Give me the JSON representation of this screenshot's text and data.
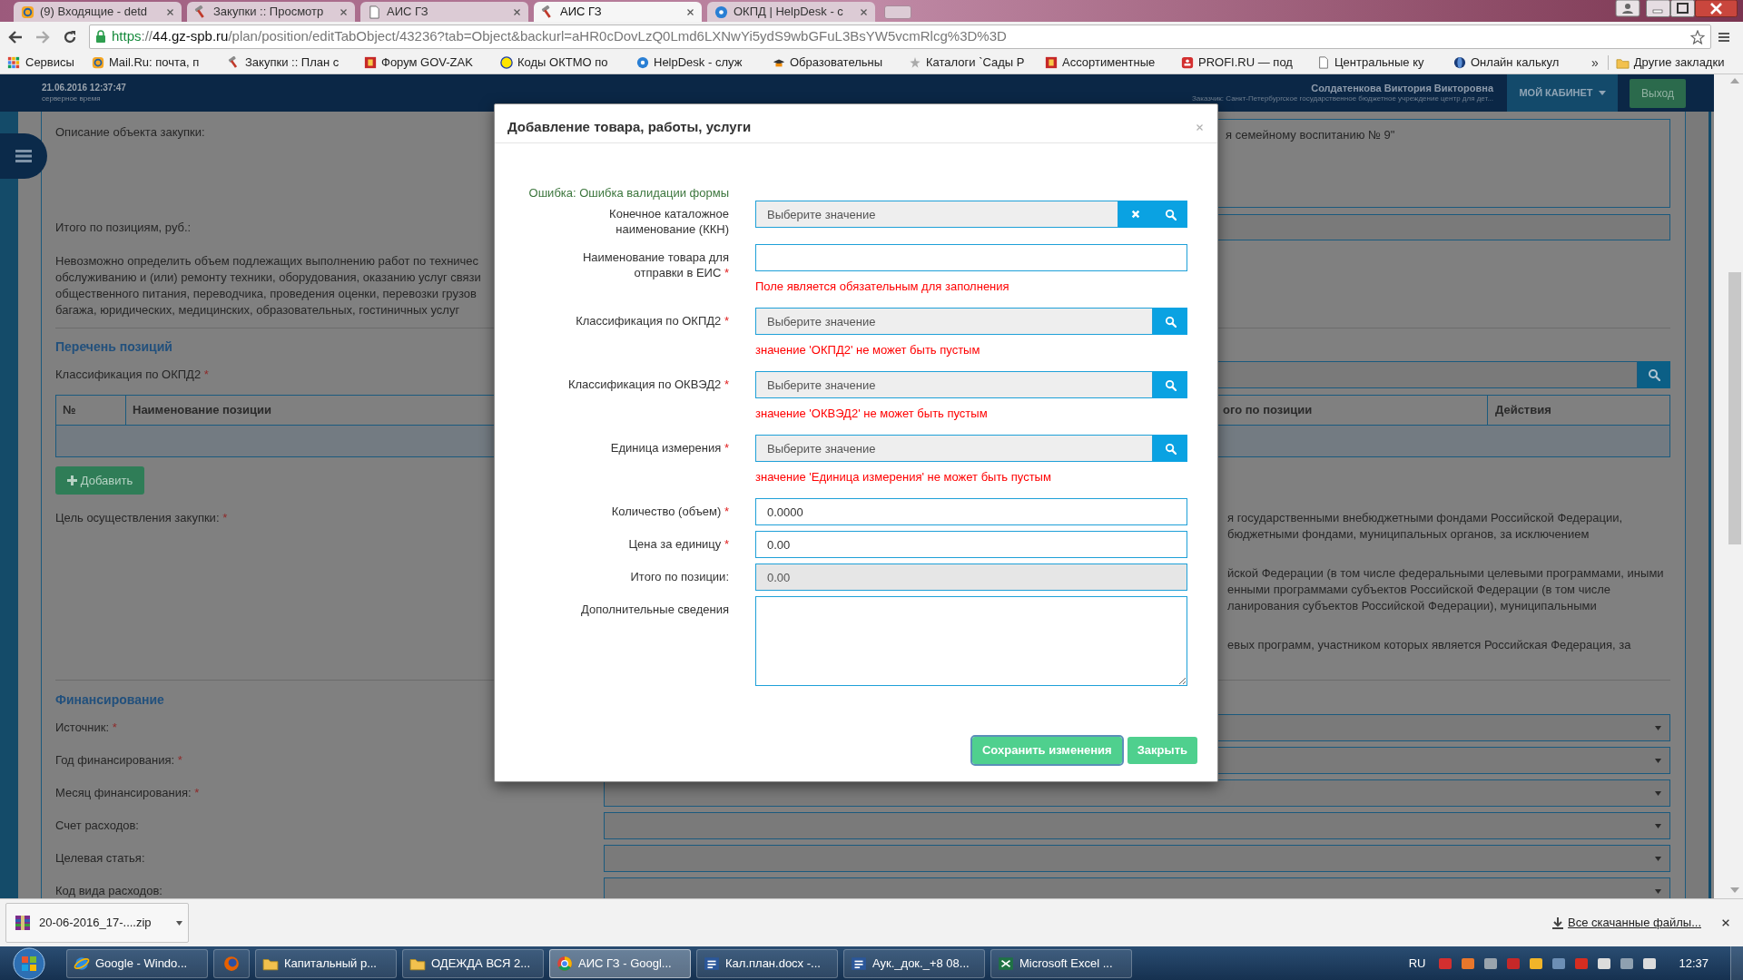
{
  "browser": {
    "tabs": [
      {
        "kind": "mail",
        "label": "(9) Входящие - detd",
        "selected": false
      },
      {
        "kind": "hammer",
        "label": "Закупки :: Просмотр",
        "selected": false
      },
      {
        "kind": "page",
        "label": "АИС ГЗ",
        "selected": false
      },
      {
        "kind": "hammer",
        "label": "АИС ГЗ",
        "selected": true
      },
      {
        "kind": "help",
        "label": "ОКПД | HelpDesk - с",
        "selected": false
      }
    ],
    "url": {
      "scheme": "https",
      "separator": "://",
      "host": "44.gz-spb.ru",
      "path": "/plan/position/editTabObject/43236?tab=Object&backurl=aHR0cDovLzQ0Lmd6LXNwYi5ydS9wbGFuL3BsYW5vcmRlcg%3D%3D"
    },
    "bookmarks": [
      {
        "kind": "apps",
        "label": "Сервисы"
      },
      {
        "kind": "mail",
        "label": "Mail.Ru: почта, п"
      },
      {
        "kind": "hammer",
        "label": "Закупки :: План с"
      },
      {
        "kind": "crest",
        "label": "Форум GOV-ZAK"
      },
      {
        "kind": "dot",
        "label": "Коды ОКТМО по"
      },
      {
        "kind": "help",
        "label": "HelpDesk - служ"
      },
      {
        "kind": "hat",
        "label": "Образовательны"
      },
      {
        "kind": "flower",
        "label": "Каталоги `Сады Р"
      },
      {
        "kind": "crest",
        "label": "Ассортиментные"
      },
      {
        "kind": "profi",
        "label": "PROFI.RU — под"
      },
      {
        "kind": "page",
        "label": "Центральные ку"
      },
      {
        "kind": "globe",
        "label": "Онлайн калькул"
      }
    ],
    "bookmarks_overflow": "»",
    "other_bookmarks": "Другие закладки"
  },
  "header": {
    "datetime": "21.06.2016 12:37:47",
    "datetime_caption": "серверное время",
    "user": "Солдатенкова Виктория Викторовна",
    "customer": "Заказчик: Санкт-Петербургское государственное бюджетное учреждение центр для дет...",
    "cabinet_menu": "МОЙ КАБИНЕТ",
    "logout": "Выход"
  },
  "page": {
    "description": {
      "label": "Описание объекта закупки:",
      "value": "я семейному воспитанию № 9\""
    },
    "total": {
      "label": "Итого по позициям, руб.:"
    },
    "note_lines": [
      "Невозможно определить объем подлежащих выполнению работ по техничес",
      "обслуживанию и (или) ремонту техники, оборудования, оказанию услуг связи",
      "общественного питания, переводчика, проведения оценки, перевозки грузов",
      "багажа, юридических, медицинских, образовательных, гостиничных услуг"
    ],
    "positions": {
      "heading": "Перечень позиций",
      "filter": {
        "label": "Классификация по ОКПД2",
        "required_mark": "*"
      },
      "columns": [
        "№",
        "Наименование позиции",
        "ого по позиции",
        "Действия"
      ],
      "add_button": "Добавить"
    },
    "purpose": {
      "label": "Цель осуществления закупки:",
      "required_mark": "*",
      "text_groups": [
        [
          "я государственными внебюджетными фондами Российской Федерации,",
          "бюджетными фондами, муниципальных органов, за исключением"
        ],
        [
          "йской Федерации (в том числе федеральными целевыми программами, иными",
          "енными программами субъектов Российской Федерации (в том числе",
          "ланирования субъектов Российской Федерации), муниципальными"
        ],
        [
          "евых программ, участником которых является Российская Федерация, за"
        ]
      ]
    },
    "financing": {
      "heading": "Финансирование",
      "fields": [
        {
          "label": "Источник:",
          "required_mark": "*"
        },
        {
          "label": "Год финансирования:",
          "required_mark": "*"
        },
        {
          "label": "Месяц финансирования:",
          "required_mark": "*"
        },
        {
          "label": "Счет расходов:"
        },
        {
          "label": "Целевая статья:"
        },
        {
          "label": "Код вида расходов:"
        }
      ]
    }
  },
  "dialog": {
    "title": "Добавление товара, работы, услуги",
    "form_error": "Ошибка: Ошибка валидации формы",
    "fields": [
      {
        "kind": "lookup",
        "label": "Конечное каталожное наименование (ККН)",
        "placeholder": "Выберите значение",
        "clearable": true
      },
      {
        "kind": "text",
        "label": "Наименование товара для отправки в ЕИС",
        "required_mark": "*",
        "disabled": false,
        "error": "Поле является обязательным для заполнения"
      },
      {
        "kind": "lookup",
        "label": "Классификация по ОКПД2",
        "required_mark": "*",
        "placeholder": "Выберите значение",
        "clearable": false,
        "error": "значение 'ОКПД2' не может быть пустым"
      },
      {
        "kind": "lookup",
        "label": "Классификация по ОКВЭД2",
        "required_mark": "*",
        "placeholder": "Выберите значение",
        "clearable": false,
        "error": "значение 'ОКВЭД2' не может быть пустым"
      },
      {
        "kind": "lookup",
        "label": "Единица измерения",
        "required_mark": "*",
        "placeholder": "Выберите значение",
        "clearable": false,
        "error": "значение 'Единица измерения' не может быть пустым"
      },
      {
        "kind": "text",
        "label": "Количество (объем)",
        "required_mark": "*",
        "value": "0.0000",
        "disabled": false
      },
      {
        "kind": "text",
        "label": "Цена за единицу",
        "required_mark": "*",
        "value": "0.00",
        "disabled": false
      },
      {
        "kind": "text",
        "label": "Итого по позиции:",
        "value": "0.00",
        "disabled": true
      },
      {
        "kind": "textarea",
        "label": "Дополнительные сведения"
      }
    ],
    "buttons": [
      {
        "label": "Сохранить изменения",
        "focused": true
      },
      {
        "label": "Закрыть",
        "focused": false
      }
    ]
  },
  "downloads": {
    "file": "20-06-2016_17-....zip",
    "all": "Все скачанные файлы..."
  },
  "taskbar": {
    "items": [
      {
        "kind": "ie",
        "label": "Google - Windo...",
        "selected": false
      },
      {
        "kind": "firefox",
        "selected": false
      },
      {
        "kind": "folder",
        "label": "Капитальный р...",
        "selected": false
      },
      {
        "kind": "folder",
        "label": "ОДЕЖДА ВСЯ 2...",
        "selected": false
      },
      {
        "kind": "chrome",
        "label": "АИС ГЗ - Googl...",
        "selected": true
      },
      {
        "kind": "word",
        "label": "Кал.план.docx -...",
        "selected": false
      },
      {
        "kind": "word",
        "label": "Аук._док._+8 08...",
        "selected": false
      },
      {
        "kind": "excel",
        "label": "Microsoft Excel ...",
        "selected": false
      }
    ],
    "language": "RU",
    "clock": "12:37"
  }
}
